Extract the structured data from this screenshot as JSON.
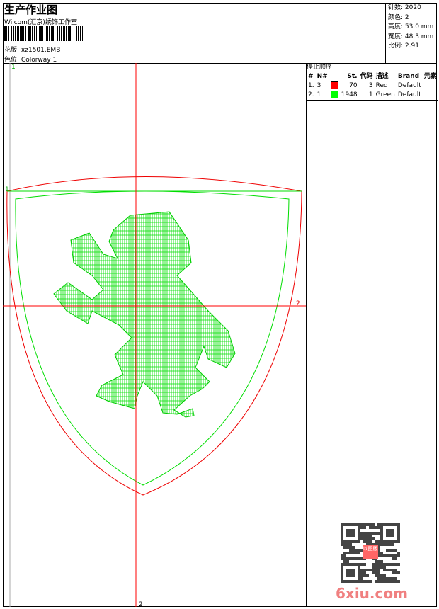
{
  "header": {
    "title": "生产作业图",
    "company": "Wilcom(汇京)绣饰工作室",
    "design_label": "花版:",
    "design": "xz1501.EMB",
    "colorway_label": "色位:",
    "colorway": "Colorway 1"
  },
  "info": {
    "stitches": "针数: 2020",
    "colors": "颜色: 2",
    "height": "高度: 53.0 mm",
    "width": "宽度: 48.3 mm",
    "scale": "比例: 2.91"
  },
  "stop_sequence": {
    "title": "停止顺序:",
    "columns": [
      "#",
      "N#",
      "St.",
      "代码",
      "描述",
      "Brand",
      "元素"
    ],
    "rows": [
      {
        "idx": "1.",
        "n": "3",
        "color": "#ff0000",
        "st": "70",
        "code": "3",
        "desc": "Red",
        "brand": "Default"
      },
      {
        "idx": "2.",
        "n": "1",
        "color": "#00ff00",
        "st": "1948",
        "code": "1",
        "desc": "Green",
        "brand": "Default"
      }
    ]
  },
  "canvas": {
    "marker_1a": "1",
    "marker_1b": "1",
    "marker_2a": "2",
    "marker_2b": "2"
  },
  "watermark": {
    "text": "6xiu.com",
    "seal": "以图版"
  }
}
